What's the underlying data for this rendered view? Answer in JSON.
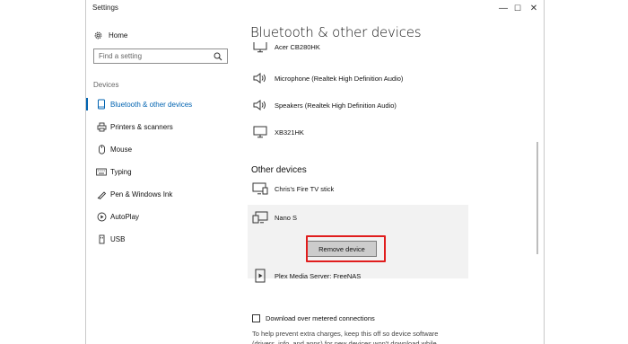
{
  "window": {
    "title": "Settings",
    "minimize_glyph": "—",
    "maximize_glyph": "☐",
    "close_glyph": "✕"
  },
  "sidebar": {
    "home_label": "Home",
    "search": {
      "placeholder": "Find a setting",
      "value": ""
    },
    "section_label": "Devices",
    "items": [
      {
        "label": "Bluetooth & other devices",
        "icon": "bluetooth-icon",
        "active": true
      },
      {
        "label": "Printers & scanners",
        "icon": "printer-icon",
        "active": false
      },
      {
        "label": "Mouse",
        "icon": "mouse-icon",
        "active": false
      },
      {
        "label": "Typing",
        "icon": "keyboard-icon",
        "active": false
      },
      {
        "label": "Pen & Windows Ink",
        "icon": "pen-icon",
        "active": false
      },
      {
        "label": "AutoPlay",
        "icon": "autoplay-icon",
        "active": false
      },
      {
        "label": "USB",
        "icon": "usb-icon",
        "active": false
      }
    ]
  },
  "main": {
    "title": "Bluetooth & other devices",
    "audio_devices": [
      {
        "name": "Acer CB280HK",
        "icon": "monitor-icon"
      },
      {
        "name": "Microphone (Realtek High Definition Audio)",
        "icon": "speaker-icon"
      },
      {
        "name": "Speakers (Realtek High Definition Audio)",
        "icon": "speaker-icon"
      },
      {
        "name": "XB321HK",
        "icon": "monitor-icon"
      }
    ],
    "other_devices_heading": "Other devices",
    "other_devices": [
      {
        "name": "Chris's Fire TV stick",
        "icon": "tv-stick-icon"
      },
      {
        "name": "Nano S",
        "icon": "device-icon",
        "selected": true
      },
      {
        "name": "Plex Media Server: FreeNAS",
        "icon": "media-server-icon"
      }
    ],
    "remove_button_label": "Remove device",
    "metered": {
      "label": "Download over metered connections",
      "checked": false,
      "help_text": "To help prevent extra charges, keep this off so device software (drivers, info, and apps) for new devices won't download while"
    }
  },
  "colors": {
    "accent": "#0063b1",
    "highlight_box": "#e01d1d",
    "selected_row_bg": "#f2f2f2",
    "button_bg": "#cccccc"
  }
}
